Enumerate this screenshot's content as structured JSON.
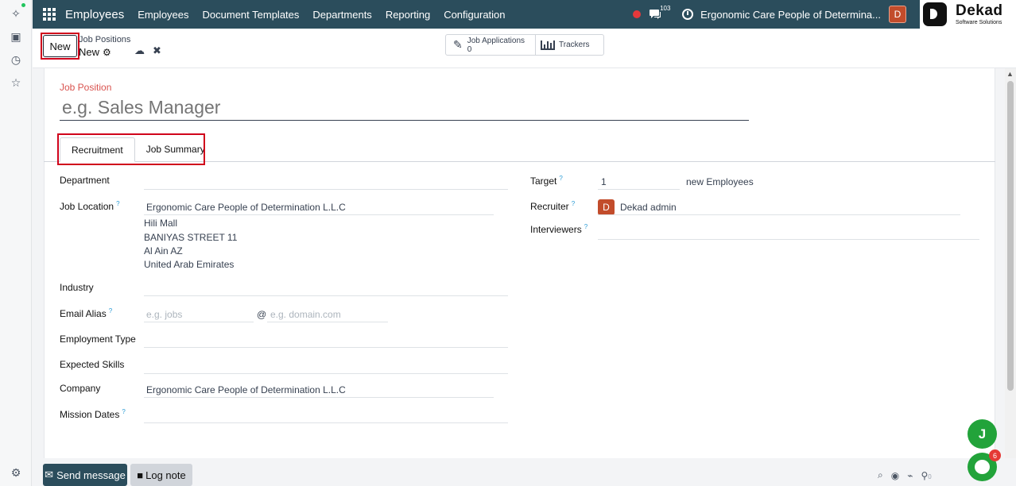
{
  "navbar": {
    "app_name": "Employees",
    "menu": [
      "Employees",
      "Document Templates",
      "Departments",
      "Reporting",
      "Configuration"
    ],
    "messages_count": "103",
    "company_name": "Ergonomic Care People of Determina...",
    "user_initial": "D"
  },
  "logo": {
    "name": "Dekad",
    "tagline": "Software Solutions"
  },
  "control_panel": {
    "new_button": "New",
    "breadcrumb_parent": "Job Positions",
    "breadcrumb_current": "New",
    "stat_job_applications_label": "Job Applications",
    "stat_job_applications_value": "0",
    "stat_trackers_label": "Trackers"
  },
  "form": {
    "job_position_label": "Job Position",
    "job_position_placeholder": "e.g. Sales Manager",
    "tabs": [
      "Recruitment",
      "Job Summary"
    ],
    "left": {
      "department_label": "Department",
      "job_location_label": "Job Location",
      "job_location_value": "Ergonomic Care People of Determination L.L.C",
      "address_lines": [
        "Hili Mall",
        "BANIYAS STREET 11",
        "Al Ain AZ",
        "United Arab Emirates"
      ],
      "industry_label": "Industry",
      "email_alias_label": "Email Alias",
      "email_alias_placeholder": "e.g. jobs",
      "email_at": "@",
      "email_domain_placeholder": "e.g. domain.com",
      "employment_type_label": "Employment Type",
      "expected_skills_label": "Expected Skills",
      "company_label": "Company",
      "company_value": "Ergonomic Care People of Determination L.L.C",
      "mission_dates_label": "Mission Dates"
    },
    "right": {
      "target_label": "Target",
      "target_value": "1",
      "target_suffix": "new Employees",
      "recruiter_label": "Recruiter",
      "recruiter_initial": "D",
      "recruiter_value": "Dekad admin",
      "interviewers_label": "Interviewers"
    },
    "help_mark": "?"
  },
  "chatter": {
    "send_message": "Send message",
    "log_note": "Log note",
    "attachment_count": "0"
  },
  "floating": {
    "user_initial": "J",
    "chat_badge": "6"
  }
}
